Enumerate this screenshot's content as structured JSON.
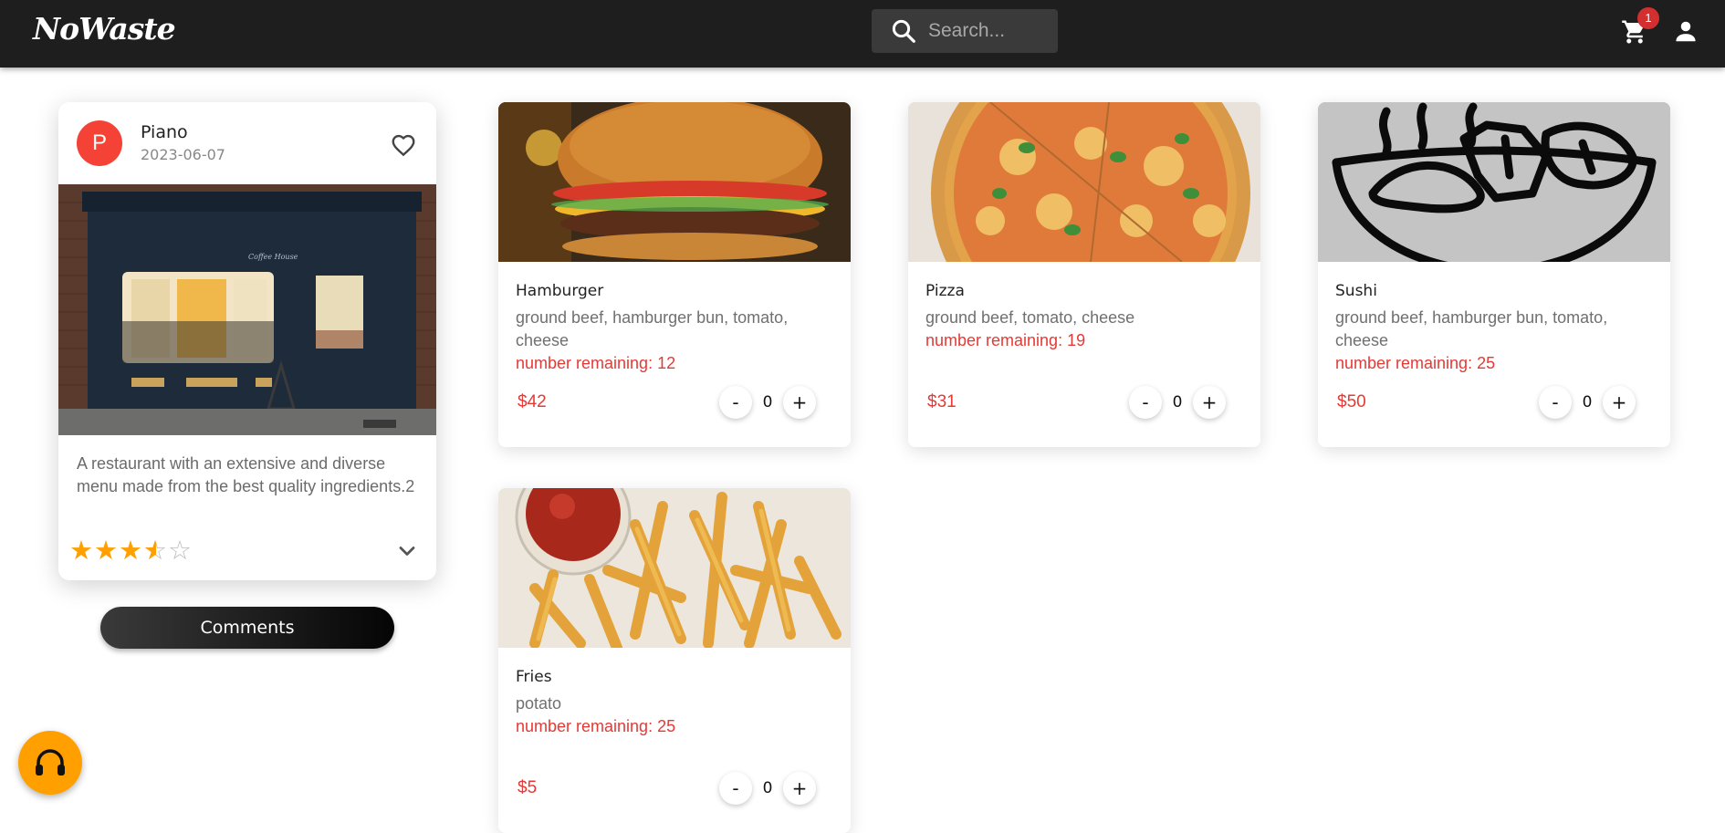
{
  "header": {
    "logo": "NoWaste",
    "search_placeholder": "Search...",
    "cart_count": "1",
    "icons": {
      "search": "search-icon",
      "cart": "cart-icon",
      "user": "account-icon"
    }
  },
  "restaurant": {
    "avatar_letter": "P",
    "name": "Piano",
    "date": "2023-06-07",
    "description": "A restaurant with an extensive and diverse menu made from the best quality ingredients.2",
    "rating": 3.5,
    "rating_max": 5,
    "comments_label": "Comments"
  },
  "products": [
    {
      "name": "Hamburger",
      "ingredients": "ground beef, hamburger bun, tomato, cheese",
      "remaining": "number remaining: 12",
      "price": "$42",
      "quantity": "0",
      "image": "burger-photo"
    },
    {
      "name": "Pizza",
      "ingredients": "ground beef, tomato, cheese",
      "remaining": "number remaining: 19",
      "price": "$31",
      "quantity": "0",
      "image": "pizza-photo"
    },
    {
      "name": "Sushi",
      "ingredients": "ground beef, hamburger bun, tomato, cheese",
      "remaining": "number remaining: 25",
      "price": "$50",
      "quantity": "0",
      "image": "bowl-placeholder-icon"
    },
    {
      "name": "Fries",
      "ingredients": "potato",
      "remaining": "number remaining: 25",
      "price": "$5",
      "quantity": "0",
      "image": "fries-photo"
    }
  ],
  "qty_labels": {
    "minus": "-",
    "plus": "+"
  },
  "colors": {
    "accent": "#e53935",
    "star": "#ffa000",
    "support": "#ffa000",
    "topbar": "#1e1e1e"
  }
}
